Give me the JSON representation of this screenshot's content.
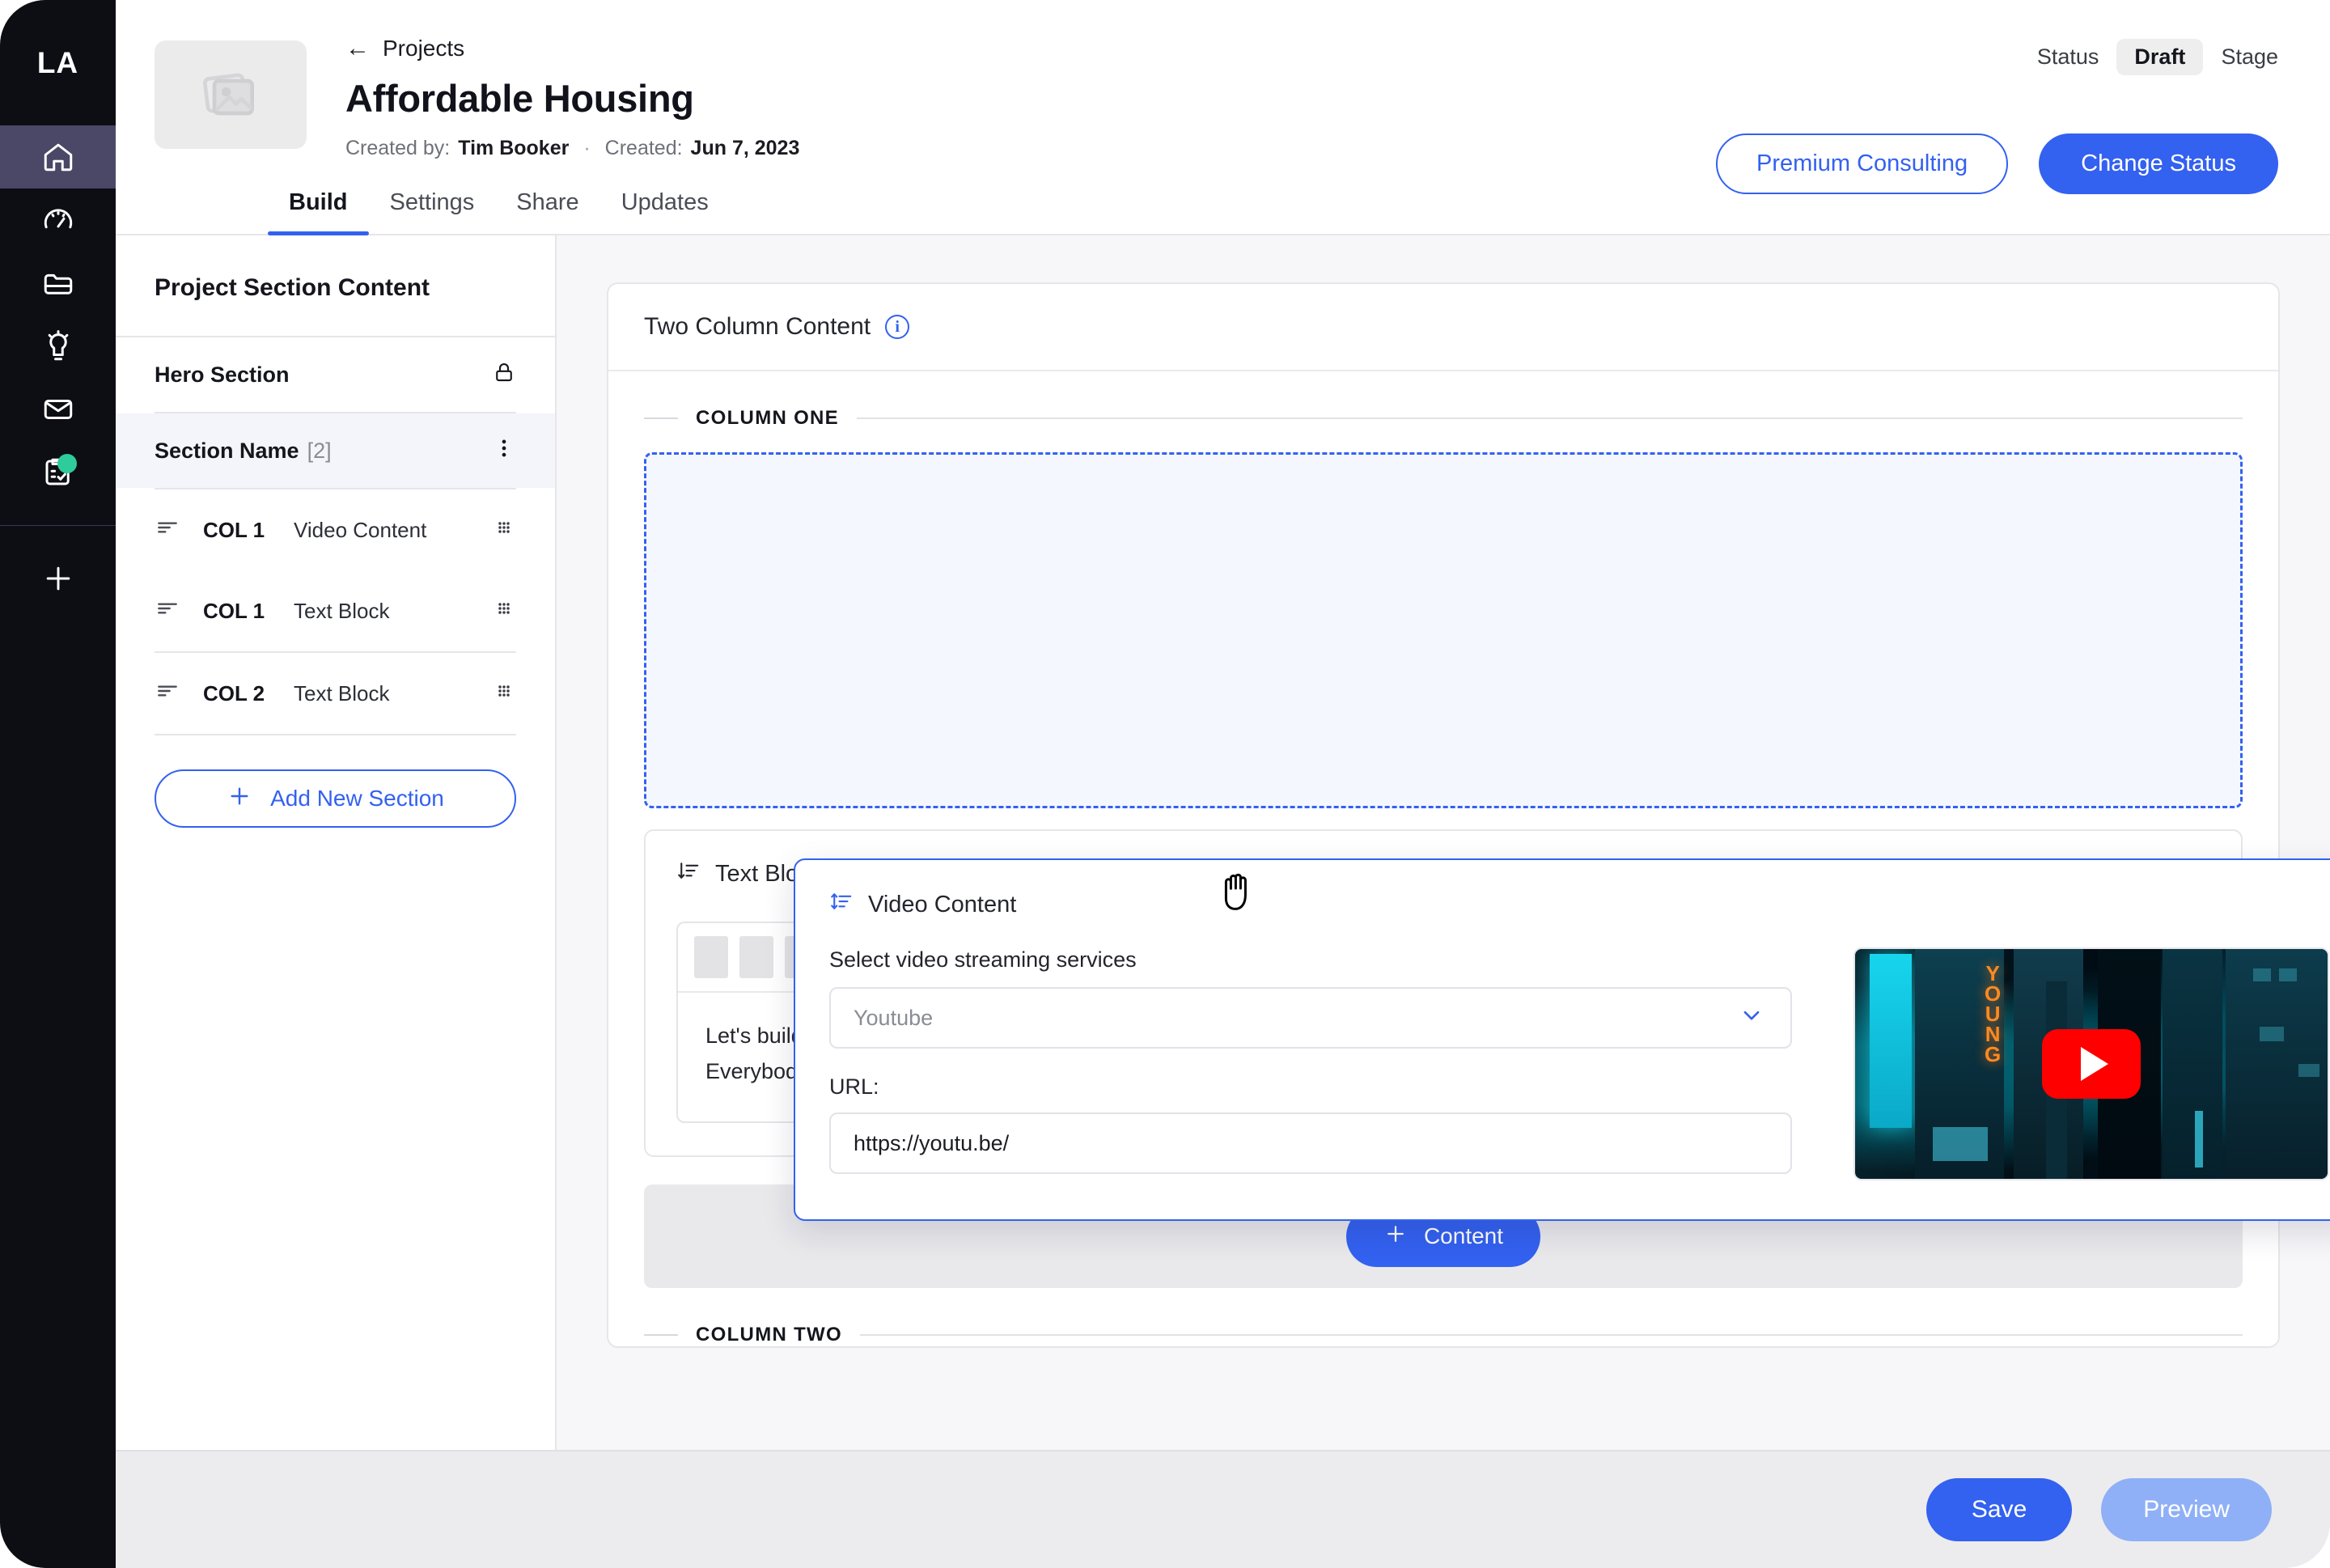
{
  "brand": {
    "logo": "LA",
    "accent": "#3361f0",
    "badge_color": "#2ecc9a"
  },
  "rail": {
    "items": [
      {
        "name": "home-icon",
        "label": "Home"
      },
      {
        "name": "gauge-icon",
        "label": "Dashboard"
      },
      {
        "name": "folder-icon",
        "label": "Files"
      },
      {
        "name": "lightbulb-icon",
        "label": "Ideas"
      },
      {
        "name": "mail-icon",
        "label": "Messages"
      },
      {
        "name": "clipboard-check-icon",
        "label": "Tasks"
      }
    ],
    "add_label": "+"
  },
  "header": {
    "breadcrumb": "Projects",
    "back_arrow": "←",
    "title": "Affordable Housing",
    "created_by_label": "Created by:",
    "created_by_value": "Tim Booker",
    "separator": "·",
    "created_label": "Created:",
    "created_value": "Jun 7, 2023",
    "status_label": "Status",
    "status_value": "Draft",
    "stage_label": "Stage",
    "premium_button": "Premium Consulting",
    "change_status_button": "Change Status"
  },
  "tabs": [
    {
      "label": "Build",
      "active": true
    },
    {
      "label": "Settings",
      "active": false
    },
    {
      "label": "Share",
      "active": false
    },
    {
      "label": "Updates",
      "active": false
    }
  ],
  "sections_panel": {
    "title": "Project Section Content",
    "hero": {
      "label": "Hero Section",
      "icon": "lock-icon"
    },
    "section": {
      "label": "Section Name",
      "count": "[2]",
      "menu_icon": "kebab-menu-icon"
    },
    "items": [
      {
        "col": "COL 1",
        "label": "Video Content"
      },
      {
        "col": "COL 1",
        "label": "Text Block"
      },
      {
        "col": "COL 2",
        "label": "Text Block"
      }
    ],
    "add_button": "Add New Section",
    "add_icon": "plus-icon"
  },
  "canvas": {
    "card_title": "Two Column Content",
    "info_icon": "info-icon",
    "column_one_label": "COLUMN ONE",
    "column_two_label": "COLUMN TWO",
    "add_content_button": "Content",
    "add_content_icon": "plus-icon"
  },
  "video_block": {
    "title": "Video Content",
    "drag_icon": "reorder-icon",
    "menu_icon": "kebab-menu-icon",
    "select_label": "Select video streaming services",
    "select_value": "Youtube",
    "chevron_icon": "chevron-down-icon",
    "url_label": "URL:",
    "url_value": "https://youtu.be/",
    "thumbnail_alt": "night city neon street",
    "neon_text": "YOUNG",
    "play_icon": "youtube-play-icon"
  },
  "text_block": {
    "title": "Text Block",
    "drag_icon": "reorder-icon",
    "menu_icon": "kebab-menu-icon",
    "toolbar_buttons": 7,
    "toolbar_extra_buttons": 1,
    "content": "Let's build some happy little clouds up here. A fan brush is a fantastic piece of equipment. Use it. Make friends with it. Just make a decision and let it go. Everybody needs a friend. Let's do it again then, what the heck. Trees cover up a multitude of sins. Let's get wild today."
  },
  "footer": {
    "save": "Save",
    "preview": "Preview"
  },
  "cursor": {
    "type": "grab-hand-cursor"
  }
}
